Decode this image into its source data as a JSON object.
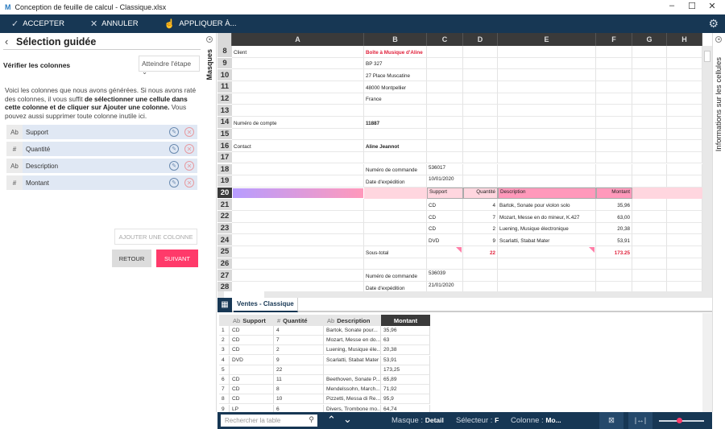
{
  "window": {
    "title": "Conception de feuille de calcul - Classique.xlsx",
    "logo": "M"
  },
  "toolbar": {
    "accept": "ACCEPTER",
    "cancel": "ANNULER",
    "apply": "APPLIQUER À..."
  },
  "left": {
    "title": "Sélection guidée",
    "step_label": "Vérifier les colonnes",
    "goto_step": "Atteindre l'étape",
    "intro_1": "Voici les colonnes que nous avons générées. Si nous avons raté des colonnes, il vous suffit ",
    "intro_bold": "de sélectionner une cellule dans cette colonne et de cliquer sur Ajouter une colonne.",
    "intro_2": " Vous pouvez aussi supprimer toute colonne inutile ici.",
    "columns": [
      {
        "type": "Ab",
        "name": "Support"
      },
      {
        "type": "#",
        "name": "Quantité"
      },
      {
        "type": "Ab",
        "name": "Description"
      },
      {
        "type": "#",
        "name": "Montant"
      }
    ],
    "add_column": "AJOUTER UNE COLONNE",
    "back": "RETOUR",
    "next": "SUIVANT"
  },
  "side_tabs": {
    "masks": "Masques",
    "cell_info": "Informations sur les cellules"
  },
  "grid": {
    "columns": [
      "A",
      "B",
      "C",
      "D",
      "E",
      "F",
      "G",
      "H"
    ],
    "selected_row": "20",
    "rows": [
      {
        "n": "8",
        "A": "Client",
        "B": "Boîte à Musique d'Aline"
      },
      {
        "n": "9",
        "B": "BP 327"
      },
      {
        "n": "10",
        "B": "27 Place Muscatine"
      },
      {
        "n": "11",
        "B": "48000 Montpellier"
      },
      {
        "n": "12",
        "B": "France"
      },
      {
        "n": "13"
      },
      {
        "n": "14",
        "A": "Numéro de compte",
        "B": "11887"
      },
      {
        "n": "15"
      },
      {
        "n": "16",
        "A": "Contact",
        "B": "Aline Jeannot"
      },
      {
        "n": "17"
      },
      {
        "n": "18",
        "B": "Numéro de commande",
        "C": "536017"
      },
      {
        "n": "19",
        "B": "Date d'expédition",
        "C": "10/01/2020"
      },
      {
        "n": "20",
        "C": "Support",
        "D": "Quantité",
        "E": "Description",
        "F": "Montant"
      },
      {
        "n": "21",
        "C": "CD",
        "D": "4",
        "E": "Bartok, Sonate pour violon solo",
        "F": "35,96"
      },
      {
        "n": "22",
        "C": "CD",
        "D": "7",
        "E": "Mozart, Messe en do mineur, K.427",
        "F": "63,00"
      },
      {
        "n": "23",
        "C": "CD",
        "D": "2",
        "E": "Luening, Musique électronique",
        "F": "20,38"
      },
      {
        "n": "24",
        "C": "DVD",
        "D": "9",
        "E": "Scarlatti, Stabat Mater",
        "F": "53,91"
      },
      {
        "n": "25",
        "B": "Sous-total",
        "D": "22",
        "F": "173.25"
      },
      {
        "n": "26"
      },
      {
        "n": "27",
        "B": "Numéro de commande",
        "C": "536039"
      },
      {
        "n": "28",
        "B": "Date d'expédition",
        "C": "21/01/2020"
      }
    ]
  },
  "sheet_tab": "Ventes - Classique",
  "table": {
    "headers": [
      {
        "type": "Ab",
        "name": "Support"
      },
      {
        "type": "#",
        "name": "Quantité"
      },
      {
        "type": "Ab",
        "name": "Description"
      },
      {
        "type": "",
        "name": "Montant"
      }
    ],
    "rows": [
      [
        "1",
        "CD",
        "4",
        "Bartok, Sonate pour...",
        "35,96"
      ],
      [
        "2",
        "CD",
        "7",
        "Mozart, Messe en do...",
        "63"
      ],
      [
        "3",
        "CD",
        "2",
        "Luening, Musique éle...",
        "20,38"
      ],
      [
        "4",
        "DVD",
        "9",
        "Scarlatti, Stabat Mater",
        "53,91"
      ],
      [
        "5",
        "",
        "22",
        "",
        "173,25"
      ],
      [
        "6",
        "CD",
        "11",
        "Beethoven, Sonate P...",
        "65,89"
      ],
      [
        "7",
        "CD",
        "8",
        "Mendelssohn, March...",
        "71,92"
      ],
      [
        "8",
        "CD",
        "10",
        "Pizzetti, Messa di Re...",
        "95,9"
      ],
      [
        "9",
        "LP",
        "6",
        "Divers, Trombone mo...",
        "64,74"
      ]
    ]
  },
  "status": {
    "search_placeholder": "Rechercher la table",
    "mask_label": "Masque : ",
    "mask_value": "Detail",
    "selector_label": "Sélecteur : ",
    "selector_value": "F",
    "column_label": "Colonne : ",
    "column_value": "Mo...",
    "zoom_level": 0.45
  },
  "colors": {
    "toolbar": "#173754",
    "accent": "#ff3a6a",
    "highlight": "#ffd6df",
    "header_pink": "#ff99bb"
  }
}
